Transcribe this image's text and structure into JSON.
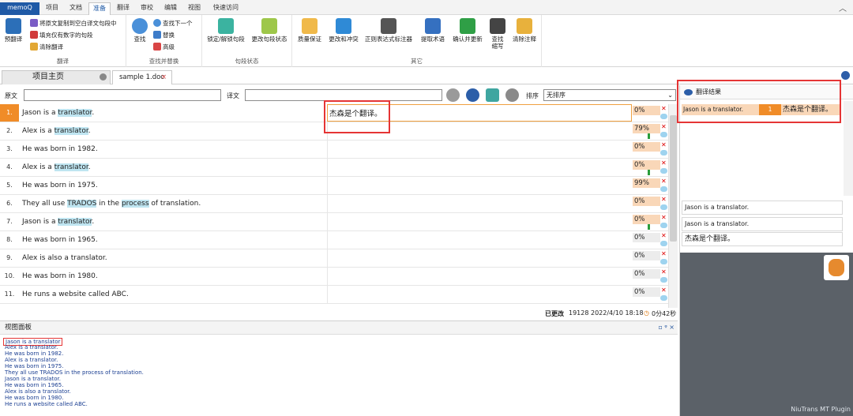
{
  "menubar": {
    "app": "memoQ",
    "tabs": [
      "项目",
      "文档",
      "准备",
      "翻译",
      "审校",
      "编辑",
      "视图",
      "快速访问"
    ],
    "active_tab": "准备",
    "collapse_icon": "chevron-up-icon"
  },
  "ribbon": {
    "translate_group": {
      "label": "翻译",
      "pretranslate": "预翻译",
      "copy_source": "将原文复制到空白译文句段中",
      "fill_numbers": "填充仅有数字的句段",
      "clear_translation": "清除翻译"
    },
    "find_group": {
      "label": "查找并替换",
      "find": "查找",
      "find_next": "查找下一个",
      "replace": "替换",
      "advanced": "高级"
    },
    "segment_group": {
      "label": "句段状态",
      "lock": "锁定/解锁句段",
      "change_status": "更改句段状态"
    },
    "other_group": {
      "label": "其它",
      "qa": "质量保证",
      "changes": "更改和冲突",
      "regex": "正则表达式标注器",
      "extract": "提取术语",
      "confirm": "确认并更新",
      "find_omissions_1": "查找",
      "find_omissions_2": "缩写",
      "clear_comments": "清除注释"
    }
  },
  "doctabs": {
    "home": "项目主页",
    "doc": "sample 1.doc",
    "close": "×"
  },
  "filterbar": {
    "source_label": "原文",
    "target_label": "译文",
    "sort_label": "排序",
    "sort_value": "无排序"
  },
  "rows": [
    {
      "num": "1.",
      "pre": "Jason is a ",
      "hl": "translator",
      "post": ".",
      "target": "杰森是个翻译。",
      "pct": "0%"
    },
    {
      "num": "2.",
      "pre": "Alex is a ",
      "hl": "translator",
      "post": ".",
      "target": "",
      "pct": "79%"
    },
    {
      "num": "3.",
      "pre": "He was born in 1982.",
      "hl": "",
      "post": "",
      "target": "",
      "pct": "0%"
    },
    {
      "num": "4.",
      "pre": "Alex is a ",
      "hl": "translator",
      "post": ".",
      "target": "",
      "pct": "0%"
    },
    {
      "num": "5.",
      "pre": "He was born in 1975.",
      "hl": "",
      "post": "",
      "target": "",
      "pct": "99%"
    },
    {
      "num": "6.",
      "pre": "They all use ",
      "hl": "TRADOS",
      "mid": " in the ",
      "hl2": "process",
      "post": " of translation.",
      "target": "",
      "pct": "0%"
    },
    {
      "num": "7.",
      "pre": "Jason is a ",
      "hl": "translator",
      "post": ".",
      "target": "",
      "pct": "0%"
    },
    {
      "num": "8.",
      "pre": "He was born in 1965.",
      "hl": "",
      "post": "",
      "target": "",
      "pct": "0%"
    },
    {
      "num": "9.",
      "pre": "Alex is also a translator.",
      "hl": "",
      "post": "",
      "target": "",
      "pct": "0%"
    },
    {
      "num": "10.",
      "pre": "He was born in 1980.",
      "hl": "",
      "post": "",
      "target": "",
      "pct": "0%"
    },
    {
      "num": "11.",
      "pre": "He runs a website called ABC.",
      "hl": "",
      "post": "",
      "target": "",
      "pct": "0%"
    }
  ],
  "statusbar": {
    "changed_label": "已更改",
    "changed_value": "19128 2022/4/10 18:18",
    "timer": "0分42秒"
  },
  "viewpanel": {
    "title": "视图面板",
    "controls": "▫ ᵠ ×",
    "lines": [
      "Jason is a translator",
      "Alex is a translator.",
      "He was born in 1982.",
      "Alex is a translator.",
      "He was born in 1975.",
      "They all use TRADOS in the process of translation.",
      "Jason is a translator.",
      "He was born in 1965.",
      "Alex is also a translator.",
      "He was born in 1980.",
      "He runs a website called ABC."
    ]
  },
  "rightpanel": {
    "title": "翻译结果",
    "result_source": "Jason is a translator.",
    "result_index": "1",
    "result_target": "杰森是个翻译。",
    "compare_1": "Jason is a translator.",
    "compare_2": "Jason is a translator.",
    "compare_3": "杰森是个翻译。",
    "plugin": "NiuTrans MT Plugin"
  }
}
